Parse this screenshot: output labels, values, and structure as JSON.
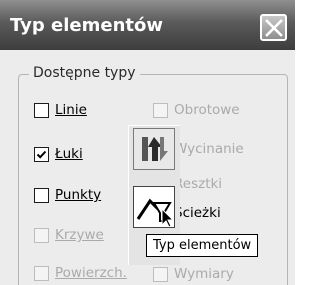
{
  "window": {
    "title": "Typ elementów"
  },
  "group": {
    "legend": "Dostępne typy"
  },
  "checkboxes_left": [
    {
      "label": "Linie",
      "checked": false,
      "enabled": true
    },
    {
      "label": "Łuki",
      "checked": true,
      "enabled": true
    },
    {
      "label": "Punkty",
      "checked": false,
      "enabled": true
    },
    {
      "label": "Krzywe",
      "checked": false,
      "enabled": false
    },
    {
      "label": "Powierzch.",
      "checked": false,
      "enabled": false
    }
  ],
  "checkboxes_right": [
    {
      "label": "Obrotowe",
      "enabled": false
    },
    {
      "label": "Wycinanie",
      "enabled": false
    },
    {
      "label": "Resztki",
      "enabled": false
    },
    {
      "label": "Ścieżki",
      "enabled": true
    },
    {
      "label": "Wymiary",
      "enabled": false
    }
  ],
  "toolbar": {
    "buttons": [
      {
        "icon": "arrows-icon",
        "pressed": false
      },
      {
        "icon": "element-type-icon",
        "pressed": true
      }
    ]
  },
  "tooltip": {
    "text": "Typ elementów"
  },
  "colors": {
    "titlebar": "#4a4a4a",
    "title_text": "#ffffff",
    "dialog_bg": "#ececec",
    "disabled_text": "#aaaaaa"
  }
}
